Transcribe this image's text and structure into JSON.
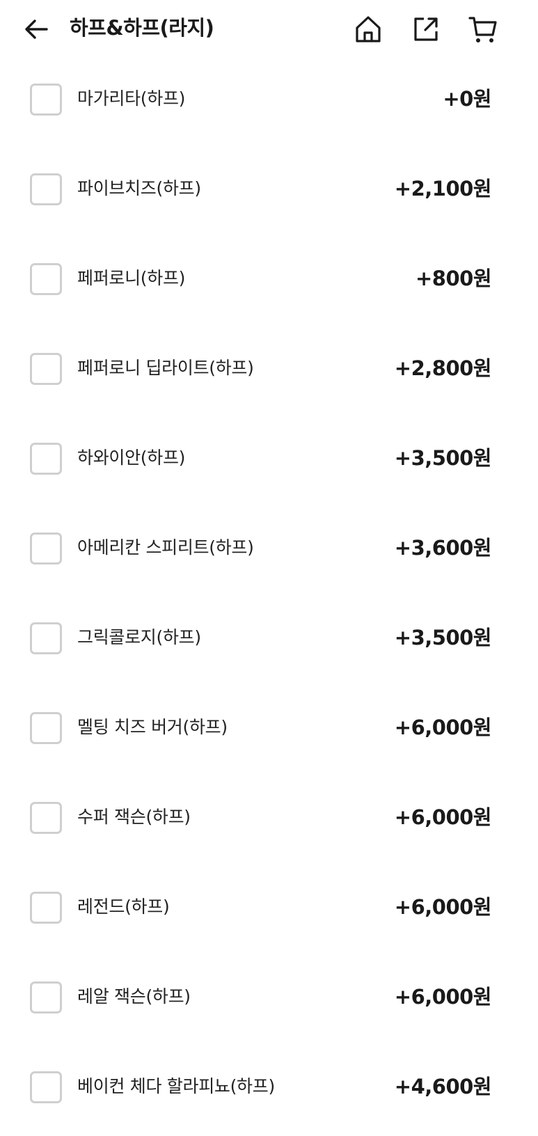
{
  "header": {
    "title": "하프&하프(라지)",
    "icons": [
      "back-arrow-icon",
      "home-icon",
      "share-icon",
      "cart-icon"
    ]
  },
  "options": [
    {
      "name": "마가리타(하프)",
      "price": "+0원",
      "checked": false
    },
    {
      "name": "파이브치즈(하프)",
      "price": "+2,100원",
      "checked": false
    },
    {
      "name": "페퍼로니(하프)",
      "price": "+800원",
      "checked": false
    },
    {
      "name": "페퍼로니 딥라이트(하프)",
      "price": "+2,800원",
      "checked": false
    },
    {
      "name": "하와이안(하프)",
      "price": "+3,500원",
      "checked": false
    },
    {
      "name": "아메리칸 스피리트(하프)",
      "price": "+3,600원",
      "checked": false
    },
    {
      "name": "그릭콜로지(하프)",
      "price": "+3,500원",
      "checked": false
    },
    {
      "name": "멜팅 치즈 버거(하프)",
      "price": "+6,000원",
      "checked": false
    },
    {
      "name": "수퍼 잭슨(하프)",
      "price": "+6,000원",
      "checked": false
    },
    {
      "name": "레전드(하프)",
      "price": "+6,000원",
      "checked": false
    },
    {
      "name": "레알 잭슨(하프)",
      "price": "+6,000원",
      "checked": false
    },
    {
      "name": "베이컨 체다 할라피뇨(하프)",
      "price": "+4,600원",
      "checked": false
    }
  ],
  "colors": {
    "text": "#1a1a1a",
    "checkbox_border": "#cfcfcf",
    "background": "#ffffff"
  }
}
